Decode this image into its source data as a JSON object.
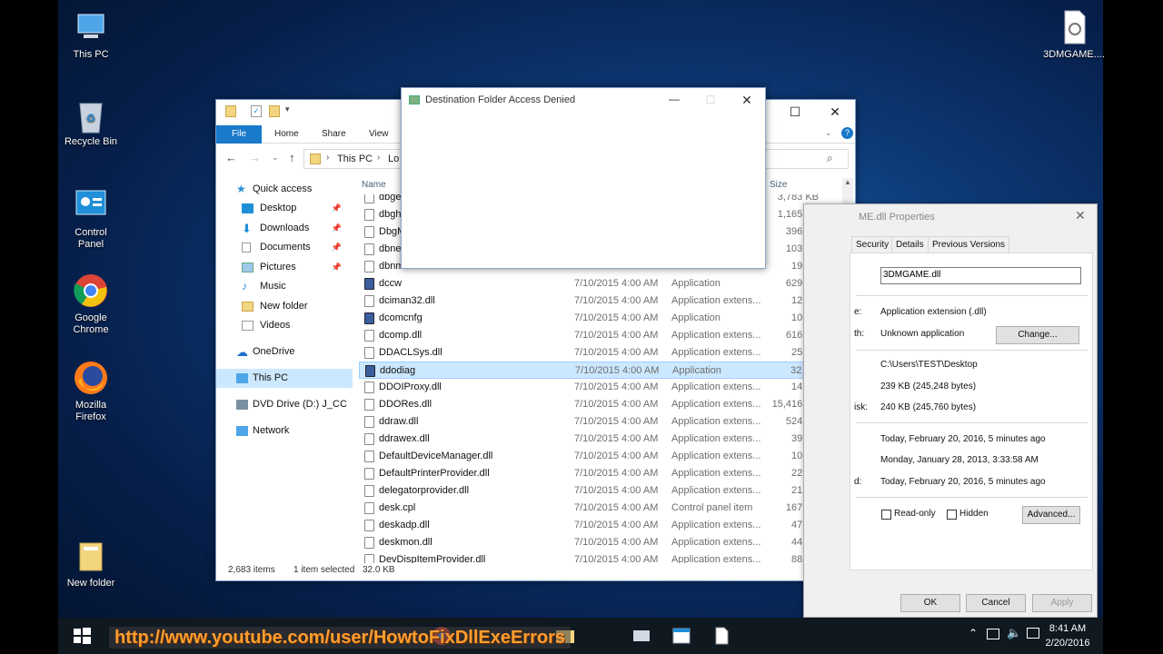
{
  "desktop": {
    "icons": [
      {
        "label": "This PC"
      },
      {
        "label": "Recycle Bin"
      },
      {
        "label": "Control Panel"
      },
      {
        "label": "Google Chrome"
      },
      {
        "label": "Mozilla Firefox"
      },
      {
        "label": "New folder"
      },
      {
        "label": "3DMGAME...."
      }
    ]
  },
  "explorer": {
    "tabs": [
      "File",
      "Home",
      "Share",
      "View"
    ],
    "address": {
      "segments": [
        "This PC",
        "Lo"
      ]
    },
    "nav": [
      {
        "label": "Quick access"
      },
      {
        "label": "Desktop",
        "pinned": true
      },
      {
        "label": "Downloads",
        "pinned": true
      },
      {
        "label": "Documents",
        "pinned": true
      },
      {
        "label": "Pictures",
        "pinned": true
      },
      {
        "label": "Music"
      },
      {
        "label": "New folder"
      },
      {
        "label": "Videos"
      },
      {
        "label": "OneDrive"
      },
      {
        "label": "This PC"
      },
      {
        "label": "DVD Drive (D:) J_CCS"
      },
      {
        "label": "Network"
      }
    ],
    "columns": {
      "name": "Name",
      "size": "Size"
    },
    "files": [
      {
        "name": "dbge",
        "date": "",
        "type": "",
        "size": "3,783 KB"
      },
      {
        "name": "dbgh",
        "date": "",
        "type": "",
        "size": "1,165 KB"
      },
      {
        "name": "DbgM",
        "date": "",
        "type": "",
        "size": "396 KB"
      },
      {
        "name": "dbne",
        "date": "",
        "type": "",
        "size": "103 KB"
      },
      {
        "name": "dbnm",
        "date": "",
        "type": "",
        "size": "19 KB"
      },
      {
        "name": "dccw",
        "date": "7/10/2015 4:00 AM",
        "type": "Application",
        "size": "629 KB",
        "icon": "app-icon"
      },
      {
        "name": "dciman32.dll",
        "date": "7/10/2015 4:00 AM",
        "type": "Application extens...",
        "size": "12 KB"
      },
      {
        "name": "dcomcnfg",
        "date": "7/10/2015 4:00 AM",
        "type": "Application",
        "size": "10 KB",
        "icon": "app-icon"
      },
      {
        "name": "dcomp.dll",
        "date": "7/10/2015 4:00 AM",
        "type": "Application extens...",
        "size": "616 KB"
      },
      {
        "name": "DDACLSys.dll",
        "date": "7/10/2015 4:00 AM",
        "type": "Application extens...",
        "size": "25 KB"
      },
      {
        "name": "ddodiag",
        "date": "7/10/2015 4:00 AM",
        "type": "Application",
        "size": "32 KB",
        "icon": "app-icon",
        "selected": true
      },
      {
        "name": "DDOIProxy.dll",
        "date": "7/10/2015 4:00 AM",
        "type": "Application extens...",
        "size": "14 KB"
      },
      {
        "name": "DDORes.dll",
        "date": "7/10/2015 4:00 AM",
        "type": "Application extens...",
        "size": "15,416 KB"
      },
      {
        "name": "ddraw.dll",
        "date": "7/10/2015 4:00 AM",
        "type": "Application extens...",
        "size": "524 KB"
      },
      {
        "name": "ddrawex.dll",
        "date": "7/10/2015 4:00 AM",
        "type": "Application extens...",
        "size": "39 KB"
      },
      {
        "name": "DefaultDeviceManager.dll",
        "date": "7/10/2015 4:00 AM",
        "type": "Application extens...",
        "size": "10 KB"
      },
      {
        "name": "DefaultPrinterProvider.dll",
        "date": "7/10/2015 4:00 AM",
        "type": "Application extens...",
        "size": "22 KB"
      },
      {
        "name": "delegatorprovider.dll",
        "date": "7/10/2015 4:00 AM",
        "type": "Application extens...",
        "size": "21 KB"
      },
      {
        "name": "desk.cpl",
        "date": "7/10/2015 4:00 AM",
        "type": "Control panel item",
        "size": "167 KB"
      },
      {
        "name": "deskadp.dll",
        "date": "7/10/2015 4:00 AM",
        "type": "Application extens...",
        "size": "47 KB"
      },
      {
        "name": "deskmon.dll",
        "date": "7/10/2015 4:00 AM",
        "type": "Application extens...",
        "size": "44 KB"
      },
      {
        "name": "DevDispItemProvider.dll",
        "date": "7/10/2015 4:00 AM",
        "type": "Application extens...",
        "size": "88 KB"
      }
    ],
    "status": {
      "items": "2,683 items",
      "selected": "1 item selected",
      "size": "32.0 KB"
    }
  },
  "dialog": {
    "title": "Destination Folder Access Denied"
  },
  "properties": {
    "title": "ME.dll Properties",
    "tabs": [
      "Security",
      "Details",
      "Previous Versions"
    ],
    "filename": "3DMGAME.dll",
    "type_value": "Application extension (.dll)",
    "opens_value": "Unknown application",
    "change_button": "Change...",
    "location": "C:\\Users\\TEST\\Desktop",
    "size": "239 KB (245,248 bytes)",
    "size_on_disk": "240 KB (245,760 bytes)",
    "created": "Today, February 20, 2016, 5 minutes ago",
    "modified": "Monday, January 28, 2013, 3:33:58 AM",
    "accessed": "Today, February 20, 2016, 5 minutes ago",
    "partial_labels": {
      "type": "e:",
      "opens": "th:",
      "disk": "isk:",
      "accessed": "d:"
    },
    "readonly_label": "Read-only",
    "hidden_label": "Hidden",
    "advanced_button": "Advanced...",
    "ok": "OK",
    "cancel": "Cancel",
    "apply": "Apply"
  },
  "taskbar": {
    "time": "8:41 AM",
    "date": "2/20/2016",
    "overlay_text": "http://www.youtube.com/user/HowtoFixDllExeErrors"
  }
}
